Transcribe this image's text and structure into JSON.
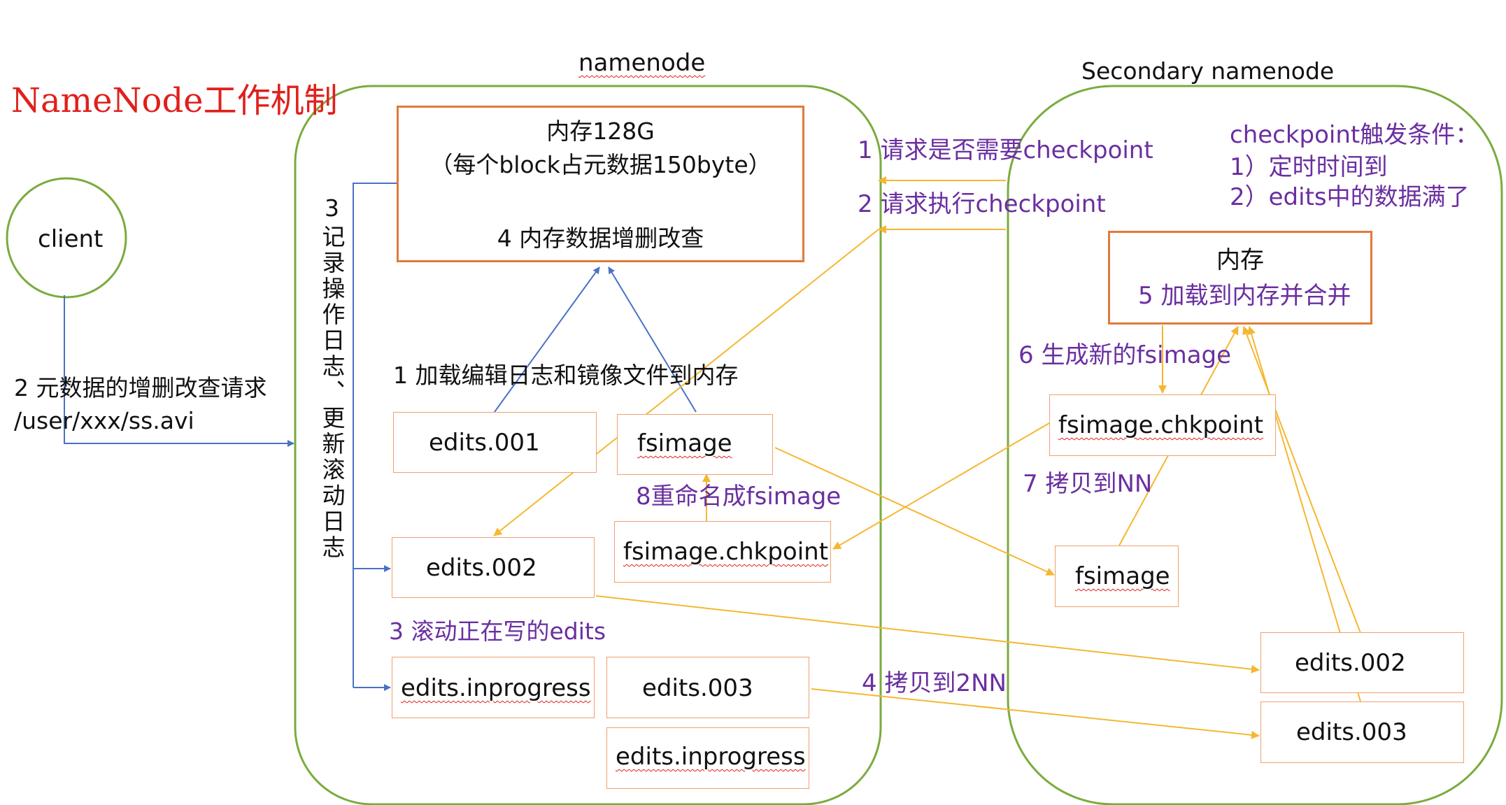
{
  "title": "NameNode工作机制",
  "client": {
    "label": "client"
  },
  "namenode": {
    "title": "namenode",
    "memory": {
      "line1": "内存128G",
      "line2": "（每个block占元数据150byte）",
      "line3": "4 内存数据增删改查"
    },
    "log_label": "3记录操作日志、更新滚动日志",
    "load_label": "1 加载编辑日志和镜像文件到内存",
    "rename_label": "8重命名成fsimage",
    "roll_label": "3 滚动正在写的edits",
    "files": {
      "edits_001": "edits.001",
      "fsimage": "fsimage",
      "fsimage_chkpoint": "fsimage.chkpoint",
      "edits_002": "edits.002",
      "edits_inprogress_a": "edits.inprogress",
      "edits_003": "edits.003",
      "edits_inprogress_b": "edits.inprogress"
    }
  },
  "request_label": {
    "line1": "2 元数据的增删改查请求",
    "line2": "/user/xxx/ss.avi"
  },
  "secondary": {
    "title": "Secondary namenode",
    "trigger": {
      "line1": "checkpoint触发条件：",
      "line2": "1）定时时间到",
      "line3": "2）edits中的数据满了"
    },
    "memory": {
      "line1": "内存",
      "line2": "5 加载到内存并合并"
    },
    "gen_label": "6 生成新的fsimage",
    "copy_nn_label": "7 拷贝到NN",
    "files": {
      "fsimage_chkpoint": "fsimage.chkpoint",
      "fsimage": "fsimage",
      "edits_002": "edits.002",
      "edits_003": "edits.003"
    }
  },
  "flow_labels": {
    "step1": "1 请求是否需要checkpoint",
    "step2": "2 请求执行checkpoint",
    "step4": "4 拷贝到2NN"
  },
  "colors": {
    "green": "#7aab3e",
    "orange": "#e07a3a",
    "light_orange": "#f0a070",
    "blue": "#4a72c4",
    "yellow": "#f5b731",
    "purple": "#6a2fa0",
    "red": "#e0201c"
  }
}
